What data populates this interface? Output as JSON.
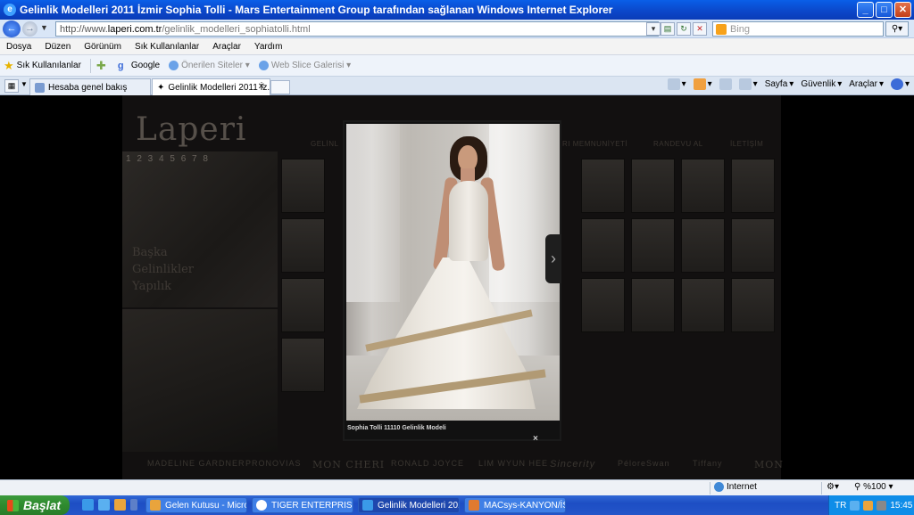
{
  "window": {
    "title": "Gelinlik Modelleri 2011 İzmir Sophia Tolli - Mars Entertainment Group tarafından sağlanan Windows Internet Explorer",
    "minimize": "_",
    "maximize": "□",
    "close": "✕"
  },
  "address": {
    "prefix": "http://www.",
    "domain": "laperi.com.tr",
    "path": "/gelinlik_modelleri_sophiatolli.html",
    "search_placeholder": "Bing"
  },
  "menu": [
    "Dosya",
    "Düzen",
    "Görünüm",
    "Sık Kullanılanlar",
    "Araçlar",
    "Yardım"
  ],
  "favorites": {
    "label": "Sık Kullanılanlar",
    "google": "Google",
    "suggested": "Önerilen Siteler",
    "webslice": "Web Slice Galerisi"
  },
  "tabs": [
    {
      "label": "Hesaba genel bakış"
    },
    {
      "label": "Gelinlik Modelleri 2011 İz..."
    }
  ],
  "commands": {
    "page": "Sayfa",
    "safety": "Güvenlik",
    "tools": "Araçlar"
  },
  "site": {
    "logo": "Laperi",
    "nav_left": "GELİNL",
    "nav_right_1": "RI MEMNUNİYETİ",
    "nav_right_2": "RANDEVU AL",
    "nav_right_3": "İLETİŞİM",
    "left_numbers": "1 2 3 4 5 6 7 8",
    "left_text": [
      "Başka",
      "Gelinlikler",
      "Yapılık"
    ],
    "brands": [
      "MADELINE GARDNER",
      "PRONOVIAS",
      "MON CHERI",
      "RONALD JOYCE",
      "LIM WYUN HEE",
      "Sincerity",
      "PéloreSwan",
      "Tiffany",
      "MON"
    ]
  },
  "lightbox": {
    "caption": "Sophia Tolli 11110 Gelinlik Modeli",
    "close": "×",
    "next": "›"
  },
  "status": {
    "zone": "Internet",
    "zoom": "%100"
  },
  "taskbar": {
    "start": "Başlat",
    "tasks": [
      {
        "label": "Gelen Kutusu - Micros..."
      },
      {
        "label": "TIGER ENTERPRISE"
      },
      {
        "label": "Gelinlik Modelleri 2011..."
      },
      {
        "label": "MACsys-KANYON/İST..."
      }
    ],
    "lang": "TR",
    "clock": "15:45"
  }
}
